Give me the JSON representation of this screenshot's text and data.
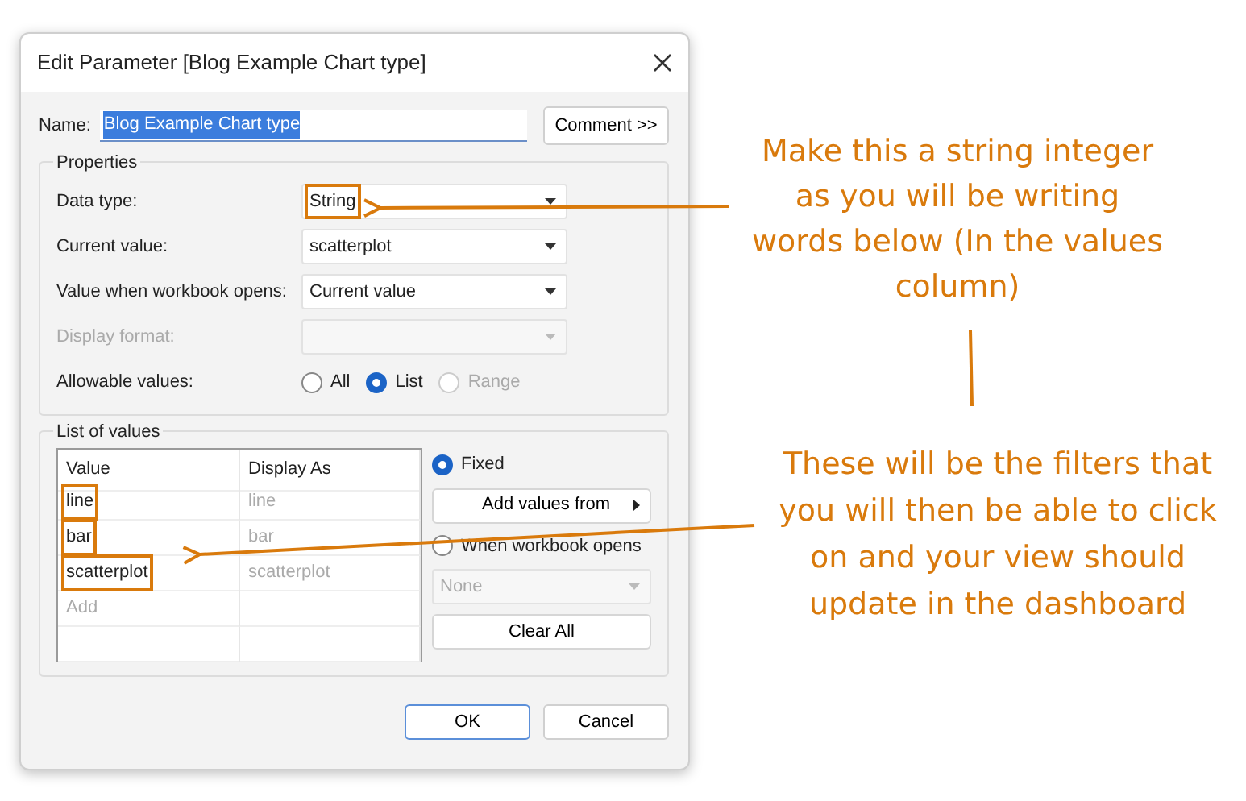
{
  "dialog": {
    "title": "Edit Parameter [Blog Example Chart type]",
    "name_label": "Name:",
    "name_value": "Blog Example Chart type",
    "name_selected": true,
    "comment_button": "Comment >>",
    "properties": {
      "legend": "Properties",
      "fields": [
        {
          "label": "Data type:",
          "value": "String",
          "disabled": false,
          "highlighted": true
        },
        {
          "label": "Current value:",
          "value": "scatterplot",
          "disabled": false,
          "highlighted": false
        },
        {
          "label": "Value when workbook opens:",
          "value": "Current value",
          "disabled": false,
          "highlighted": false
        },
        {
          "label": "Display format:",
          "disabled": true
        }
      ],
      "allowable": {
        "label": "Allowable values:",
        "options": [
          {
            "label": "All",
            "selected": false,
            "disabled": false
          },
          {
            "label": "List",
            "selected": true,
            "disabled": false
          },
          {
            "label": "Range",
            "selected": false,
            "disabled": true
          }
        ]
      }
    },
    "list_of_values": {
      "legend": "List of values",
      "columns": [
        "Value",
        "Display As"
      ],
      "rows": [
        {
          "value": "line",
          "display": "line",
          "highlighted": true
        },
        {
          "value": "bar",
          "display": "bar",
          "highlighted": true
        },
        {
          "value": "scatterplot",
          "display": "scatterplot",
          "highlighted": true
        }
      ],
      "add_placeholder": "Add",
      "source_options": [
        {
          "label": "Fixed",
          "selected": true
        },
        {
          "label": "When workbook opens",
          "selected": false
        }
      ],
      "add_values_button": "Add values from",
      "source_dropdown": {
        "value": "None",
        "disabled": true
      },
      "clear_all_button": "Clear All"
    },
    "buttons": [
      {
        "label": "OK",
        "default": true
      },
      {
        "label": "Cancel",
        "default": false
      }
    ]
  },
  "annotations": [
    {
      "text": "Make this a string integer as you will be writing words below (In the values column)"
    },
    {
      "text": "These will be the filters that you will then be able to click on and your view should update in the dashboard"
    }
  ]
}
